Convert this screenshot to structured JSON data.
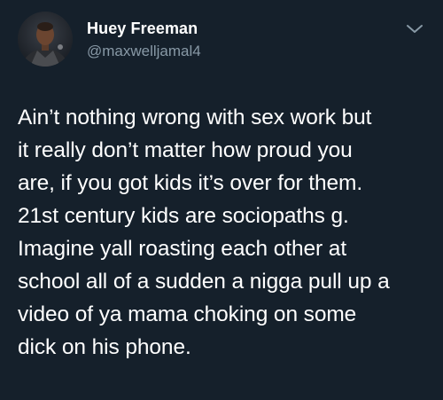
{
  "author": {
    "display_name": "Huey Freeman",
    "handle": "@maxwelljamal4"
  },
  "icons": {
    "menu": "chevron-down-icon",
    "avatar": "avatar"
  },
  "tweet": {
    "text": "Ain’t nothing wrong with sex work but\nit really don’t matter how proud you\nare, if you got kids it’s over for them.\n21st century kids are sociopaths g.\nImagine yall roasting each other at\nschool all of a sudden a nigga pull up a\nvideo of ya mama choking on some\ndick on his phone."
  },
  "colors": {
    "background": "#15202b",
    "primary_text": "#ffffff",
    "secondary_text": "#8899a6"
  }
}
